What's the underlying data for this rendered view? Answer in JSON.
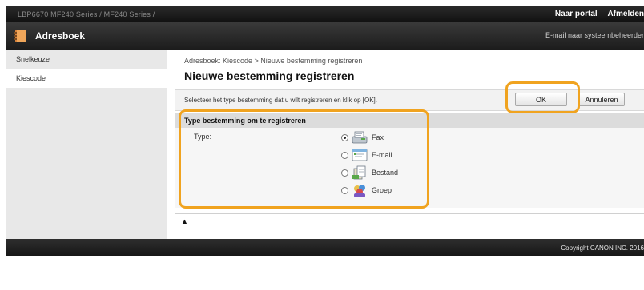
{
  "topbar": {
    "model": "LBP6670   MF240 Series / MF240 Series /",
    "portal_link": "Naar portal",
    "logout_link": "Afmelden"
  },
  "header": {
    "title": "Adresboek",
    "admin_link": "E-mail naar systeembeheerder"
  },
  "sidebar": {
    "items": [
      {
        "label": "Snelkeuze",
        "selected": false
      },
      {
        "label": "Kiescode",
        "selected": true
      }
    ]
  },
  "main": {
    "breadcrumb": "Adresboek: Kiescode > Nieuwe bestemming registreren",
    "title": "Nieuwe bestemming registreren",
    "instruction": "Selecteer het type bestemming dat u wilt registreren en klik op [OK].",
    "ok_label": "OK",
    "cancel_label": "Annuleren",
    "section_title": "Type bestemming om te registreren",
    "type_label": "Type:",
    "options": [
      {
        "label": "Fax",
        "icon": "fax-icon",
        "selected": true
      },
      {
        "label": "E-mail",
        "icon": "email-icon",
        "selected": false
      },
      {
        "label": "Bestand",
        "icon": "file-icon",
        "selected": false
      },
      {
        "label": "Groep",
        "icon": "group-icon",
        "selected": false
      }
    ],
    "top_link": "▲"
  },
  "footer": {
    "copyright": "Copyright CANON INC. 2016"
  },
  "colors": {
    "highlight": "#f0a31f",
    "header_bg": "#1c1c1c",
    "sidebar_bg": "#e8e8e8"
  }
}
